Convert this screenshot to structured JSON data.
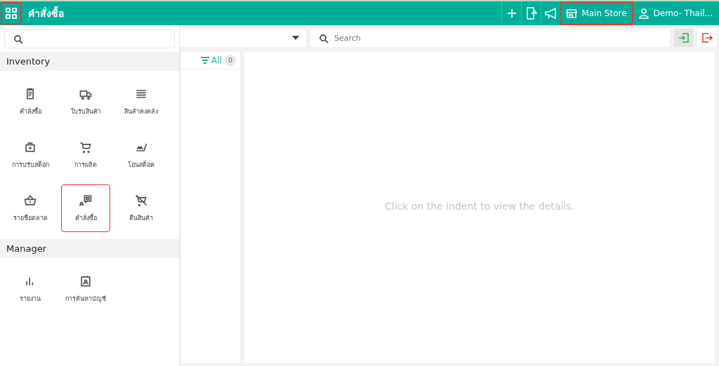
{
  "topbar": {
    "title": "คำสั่งซื้อ",
    "menu_highlighted": true,
    "store": {
      "label": "Main Store",
      "highlighted": true
    },
    "user": {
      "label": "Demo- Thail..."
    }
  },
  "drawer": {
    "sections": [
      {
        "title": "Inventory",
        "items": [
          {
            "label": "คำสั่งซื้อ",
            "highlighted": false
          },
          {
            "label": "ใบรับสินค้า",
            "highlighted": false
          },
          {
            "label": "สินค้าคงคลัง",
            "highlighted": false
          },
          {
            "label": "การปรับสต็อก",
            "highlighted": false
          },
          {
            "label": "การผลิต",
            "highlighted": false
          },
          {
            "label": "โอนสต็อค",
            "highlighted": false
          },
          {
            "label": "รายชื่อตลาด",
            "highlighted": false
          },
          {
            "label": "คำสั่งซื้อ",
            "highlighted": true
          },
          {
            "label": "คืนสินค้า",
            "highlighted": false
          }
        ]
      },
      {
        "title": "Manager",
        "items": [
          {
            "label": "รายงาน",
            "highlighted": false
          },
          {
            "label": "การค้นหาบัญชี",
            "highlighted": false
          }
        ]
      }
    ]
  },
  "toolbar": {
    "search": {
      "placeholder": "Search"
    }
  },
  "list": {
    "filter": {
      "label": "All",
      "count": "0"
    }
  },
  "detail": {
    "message": "Click on the indent to view the details."
  }
}
